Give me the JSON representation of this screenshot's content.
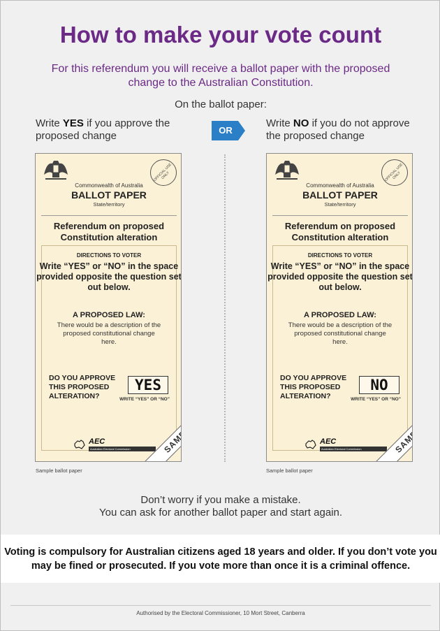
{
  "title": "How to make your vote count",
  "subtitle": "For this referendum you will receive a ballot paper with the proposed change to the Australian Constitution.",
  "on_ballot": "On the ballot paper:",
  "instructions": {
    "yes_word": "YES",
    "yes_prefix": "Write ",
    "yes_suffix": " if you approve the proposed change",
    "no_word": "NO",
    "no_prefix": "Write ",
    "no_suffix": " if you do not approve the proposed change",
    "or_label": "OR",
    "or_color": "#2a7fc6"
  },
  "ballot": {
    "commonwealth": "Commonwealth of Australia",
    "heading": "BALLOT PAPER",
    "state": "State/territory",
    "official_use": "OFFICIAL USE ONLY",
    "referendum": "Referendum on proposed Constitution alteration",
    "directions_heading": "DIRECTIONS TO VOTER",
    "directions_body": "Write “YES” or “NO” in the space provided opposite the question set out below.",
    "law_heading": "A PROPOSED LAW:",
    "law_body": "There would be a description of the proposed constitutional change here.",
    "question": "DO YOU APPROVE THIS PROPOSED ALTERATION?",
    "write_yes_no": "WRITE “YES” OR “NO”",
    "aec": "AEC",
    "aec_sub": "Australian Electoral Commission",
    "sample": "SAMPLE",
    "caption": "Sample ballot paper",
    "left_answer": "YES",
    "right_answer": "NO",
    "paper_color": "#fbf1d6"
  },
  "mistake_line1": "Don’t worry if you make a mistake.",
  "mistake_line2": "You can ask for another ballot paper and start again.",
  "compulsory": "Voting is compulsory for Australian citizens aged 18 years and older. If you don’t vote you may be fined or prosecuted. If you vote more than once it is a criminal offence.",
  "authorised": "Authorised by the Electoral Commissioner, 10 Mort Street, Canberra",
  "colors": {
    "title": "#6b2a86",
    "background": "#f0f0f0"
  }
}
